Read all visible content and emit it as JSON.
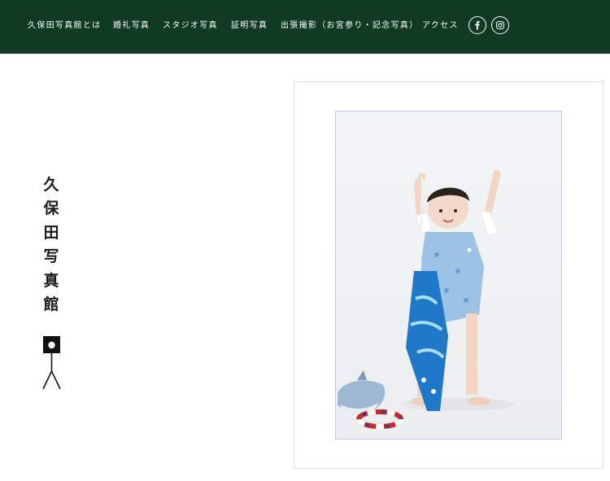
{
  "header": {
    "background": "#0f3b23",
    "nav": [
      "久保田写真館とは",
      "婚礼写真",
      "スタジオ写真",
      "証明写真",
      "出張撮影（お宮参り・記念写真）",
      "アクセス"
    ],
    "social": [
      "facebook-icon",
      "instagram-icon"
    ]
  },
  "logo": {
    "text": "久保田写真館",
    "mark": "camera-tripod-icon"
  },
  "hero": {
    "image": "photo of a toddler in a blue floral outfit holding a blue drawstring bag, with a plush dolphin and a striped ring on the floor"
  }
}
